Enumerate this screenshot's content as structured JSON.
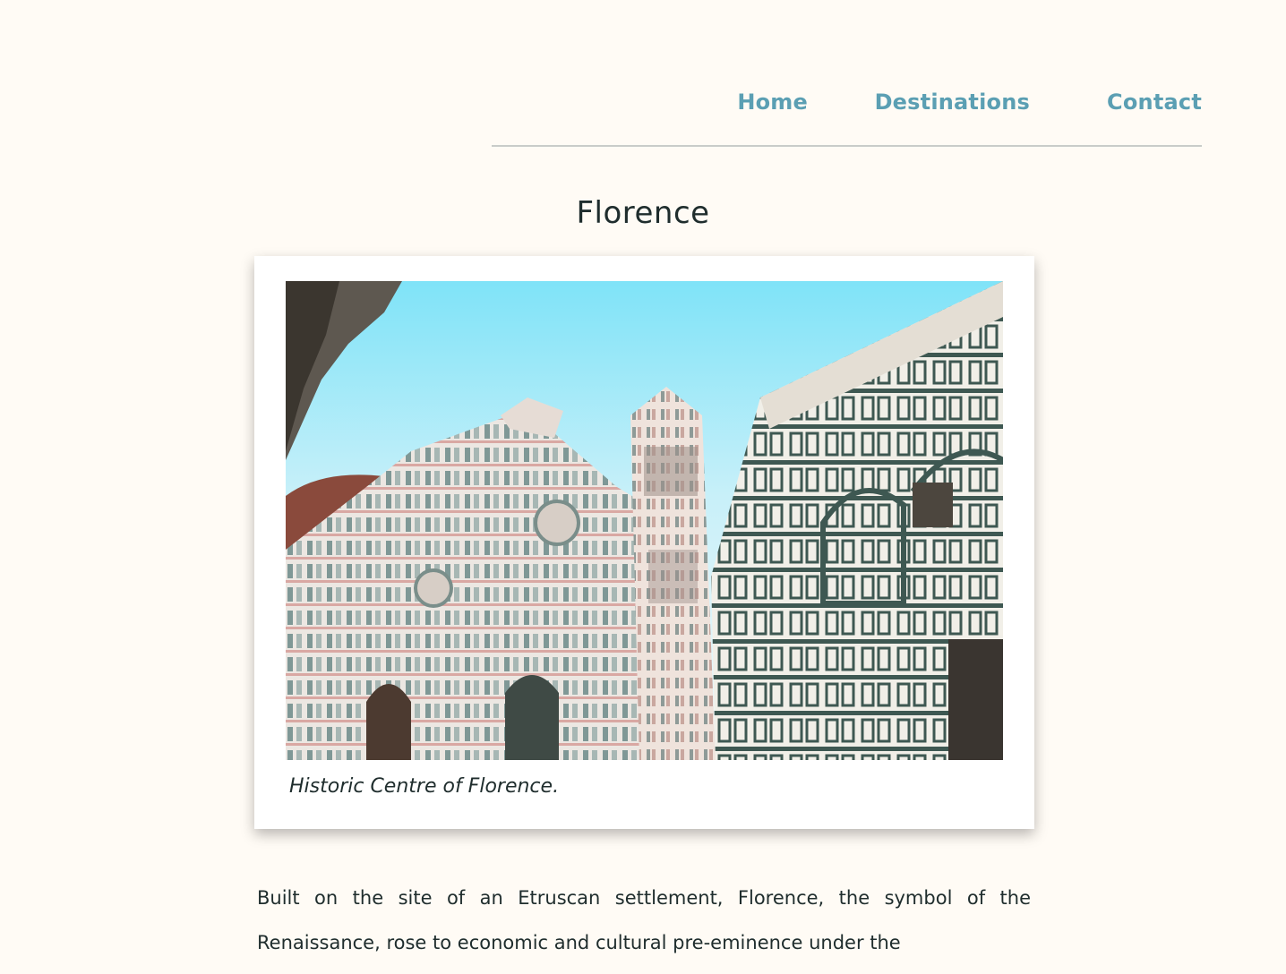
{
  "nav": {
    "items": [
      {
        "label": "Home"
      },
      {
        "label": "Destinations"
      },
      {
        "label": "Contact"
      }
    ]
  },
  "page": {
    "title": "Florence"
  },
  "figure": {
    "caption": "Historic Centre of Florence."
  },
  "article": {
    "text": "Built on the site of an Etruscan settlement, Florence, the symbol of the Renaissance, rose to economic and cultural pre-eminence under the"
  },
  "colors": {
    "background": "#fffbf5",
    "nav_link": "#5b9fb3",
    "text": "#1f2d2d",
    "divider": "#c9ccc9"
  }
}
